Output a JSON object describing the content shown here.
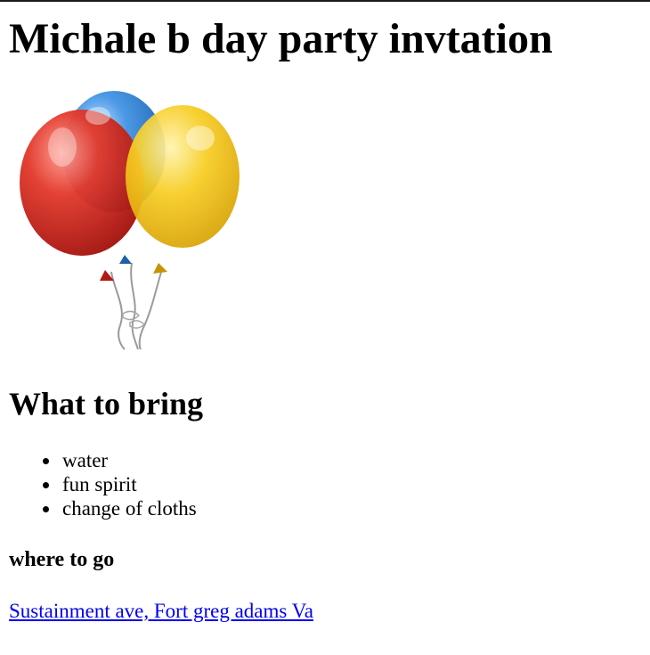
{
  "page": {
    "title": "Michale b day party invtation"
  },
  "image": {
    "icon": "balloons-icon",
    "colors": {
      "blue": "#3a86d4",
      "red": "#d8231c",
      "yellow": "#f5c414"
    }
  },
  "bring_section": {
    "heading": "What to bring",
    "items": [
      {
        "label": "water"
      },
      {
        "label": "fun spirit"
      },
      {
        "label": "change of cloths"
      }
    ]
  },
  "location_section": {
    "heading": "where to go",
    "link_text": "Sustainment ave, Fort greg adams Va",
    "link_color": "#0000ee"
  }
}
